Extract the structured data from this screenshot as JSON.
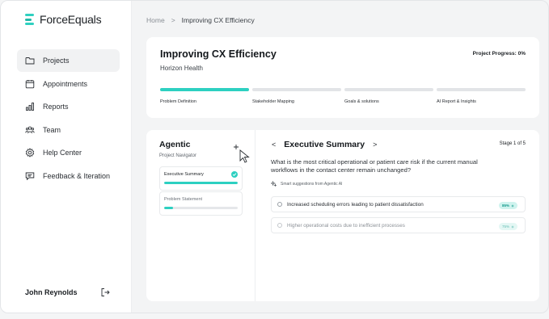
{
  "app": {
    "name": "ForceEquals"
  },
  "sidebar": {
    "items": [
      {
        "label": "Projects",
        "icon": "folder-icon",
        "active": true
      },
      {
        "label": "Appointments",
        "icon": "calendar-icon",
        "active": false
      },
      {
        "label": "Reports",
        "icon": "bar-chart-icon",
        "active": false
      },
      {
        "label": "Team",
        "icon": "team-icon",
        "active": false
      },
      {
        "label": "Help Center",
        "icon": "gear-icon",
        "active": false
      },
      {
        "label": "Feedback & Iteration",
        "icon": "chat-icon",
        "active": false
      }
    ],
    "user": {
      "name": "John Reynolds",
      "logout_icon": "logout-icon"
    }
  },
  "breadcrumb": {
    "home": "Home",
    "separator": ">",
    "current": "Improving CX Efficiency"
  },
  "project": {
    "title": "Improving CX Efficiency",
    "client": "Horizon Health",
    "progress_label": "Project Progress: 0%",
    "stages": [
      {
        "label": "Problem Definition",
        "active": true
      },
      {
        "label": "Stakeholder Mapping",
        "active": false
      },
      {
        "label": "Goals & solutions",
        "active": false
      },
      {
        "label": "AI Report & Insights",
        "active": false
      }
    ]
  },
  "navigator": {
    "title": "Agentic",
    "subtitle": "Project Navigator",
    "items": [
      {
        "label": "Executive Summary",
        "progress": 1.0,
        "complete": true
      },
      {
        "label": "Problem Statement",
        "progress": 0.12,
        "complete": false
      }
    ]
  },
  "summary": {
    "prev": "<",
    "next": ">",
    "title": "Executive Summary",
    "stage_count": "Stage 1 of 5",
    "question": "What is the most critical operational or patient care risk if the current manual workflows in the contact center remain unchanged?",
    "smart_label": "Smart suggestions from Agentic AI",
    "options": [
      {
        "text": "Increased scheduling errors leading to patient dissatisfaction",
        "score": "85%"
      },
      {
        "text": "Higher operational costs due to inefficient processes",
        "score": "75%"
      }
    ]
  },
  "colors": {
    "accent": "#2dd0c1",
    "background": "#f3f4f5"
  }
}
